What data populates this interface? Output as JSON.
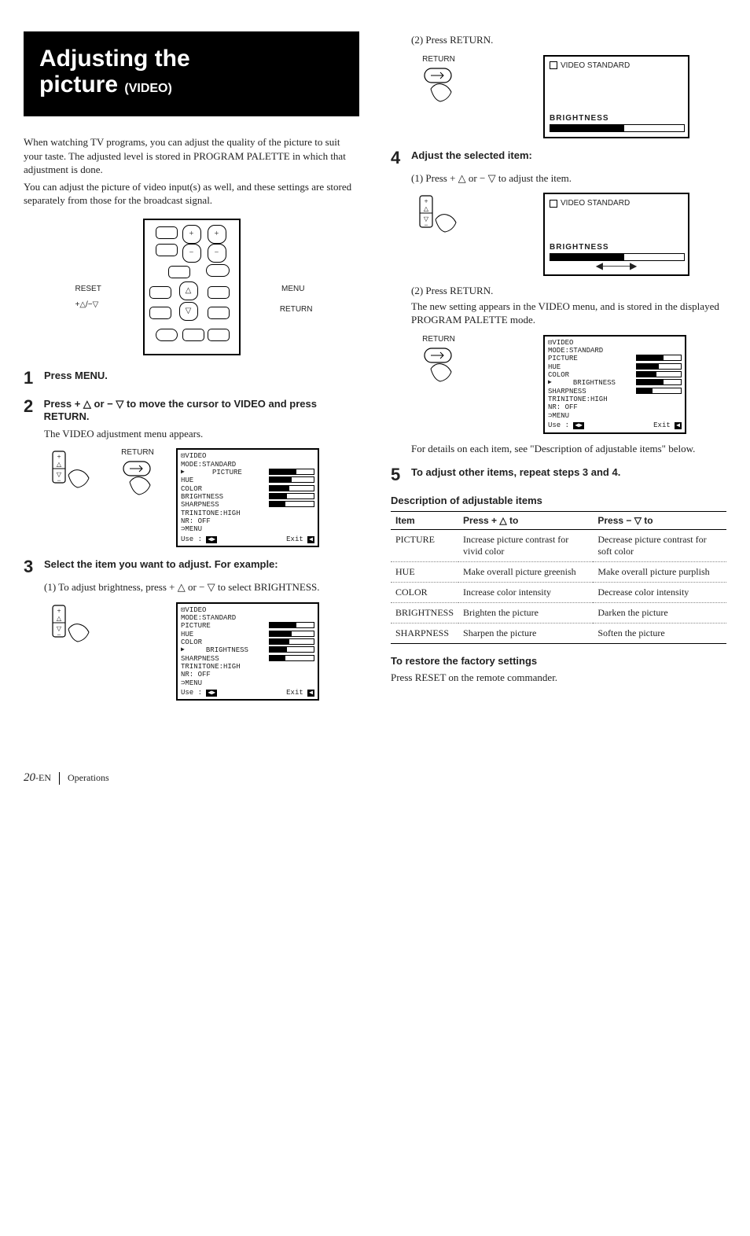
{
  "title": {
    "line1": "Adjusting the",
    "line2": "picture",
    "suffix": "(VIDEO)"
  },
  "intro": {
    "p1": "When watching TV programs, you can adjust the quality of the picture to suit your taste. The adjusted level is stored in PROGRAM PALETTE in which that adjustment is done.",
    "p2": "You can adjust the picture of video input(s) as well, and these settings are stored separately from those for the broadcast signal."
  },
  "remote_labels": {
    "reset": "RESET",
    "arrows": "+△/−▽",
    "menu": "MENU",
    "return": "RETURN"
  },
  "steps": {
    "s1": {
      "head": "Press MENU."
    },
    "s2": {
      "head": "Press + △ or − ▽ to move the cursor to VIDEO and press RETURN.",
      "body": "The VIDEO adjustment menu appears."
    },
    "s3": {
      "head": "Select the item you want to adjust. For example:",
      "sub1": "(1) To adjust brightness, press + △ or − ▽ to select BRIGHTNESS."
    },
    "s3b": {
      "sub2": "(2) Press RETURN."
    },
    "s4": {
      "head": "Adjust the selected item:",
      "sub1": "(1) Press + △ or − ▽ to adjust the item.",
      "sub2": "(2) Press RETURN.",
      "sub2b": "The new setting appears in the VIDEO menu, and is stored in the displayed PROGRAM PALETTE mode.",
      "note": "For details on each item, see \"Description of adjustable items\" below."
    },
    "s5": {
      "head": "To adjust other items, repeat steps 3 and 4."
    }
  },
  "hand": {
    "return": "RETURN"
  },
  "osd": {
    "title": "VIDEO",
    "mode": "MODE:STANDARD",
    "items": [
      "PICTURE",
      "HUE",
      "COLOR",
      "BRIGHTNESS",
      "SHARPNESS",
      "TRINITONE:HIGH",
      "NR:            OFF",
      "⊃MENU"
    ],
    "use": "Use :",
    "exit": "Exit"
  },
  "osd_big": {
    "title": "VIDEO STANDARD",
    "brightness_label": "BRIGHTNESS"
  },
  "desc": {
    "title": "Description of adjustable items",
    "head": {
      "c1": "Item",
      "c2": "Press + △ to",
      "c3": "Press − ▽ to"
    },
    "rows": [
      {
        "c1": "PICTURE",
        "c2": "Increase picture contrast for vivid color",
        "c3": "Decrease picture contrast for soft color"
      },
      {
        "c1": "HUE",
        "c2": "Make overall picture greenish",
        "c3": "Make overall picture purplish"
      },
      {
        "c1": "COLOR",
        "c2": "Increase color intensity",
        "c3": "Decrease color intensity"
      },
      {
        "c1": "BRIGHTNESS",
        "c2": "Brighten the picture",
        "c3": "Darken the picture"
      },
      {
        "c1": "SHARPNESS",
        "c2": "Sharpen the picture",
        "c3": "Soften the picture"
      }
    ]
  },
  "restore": {
    "head": "To restore the factory settings",
    "body": "Press RESET on the remote commander."
  },
  "footer": {
    "page": "20",
    "suffix": "-EN",
    "section": "Operations"
  }
}
